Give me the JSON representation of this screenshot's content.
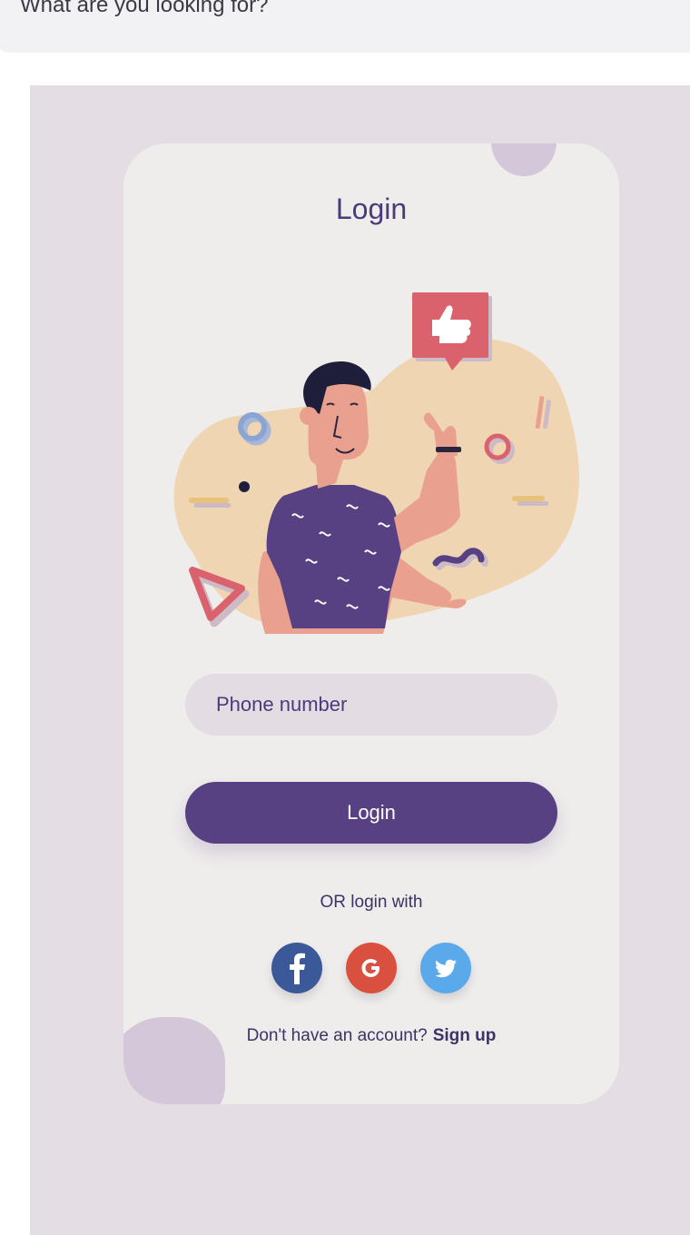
{
  "search": {
    "placeholder": "What are you looking for?"
  },
  "screen": {
    "title": "Login",
    "phone_placeholder": "Phone number",
    "login_button": "Login",
    "or_text": "OR login with",
    "social": [
      {
        "name": "facebook",
        "icon": "facebook-icon",
        "color": "#3b5999",
        "glyph": "f"
      },
      {
        "name": "google",
        "icon": "google-icon",
        "color": "#d9503f",
        "glyph": "G"
      },
      {
        "name": "twitter",
        "icon": "twitter-icon",
        "color": "#5aa9ea",
        "glyph": ""
      }
    ],
    "no_account_text": "Don't have an account?",
    "signup_link": "Sign up"
  },
  "colors": {
    "accent": "#574182",
    "background": "#e4dde4",
    "card": "#efecec",
    "input": "#e3dce3"
  }
}
